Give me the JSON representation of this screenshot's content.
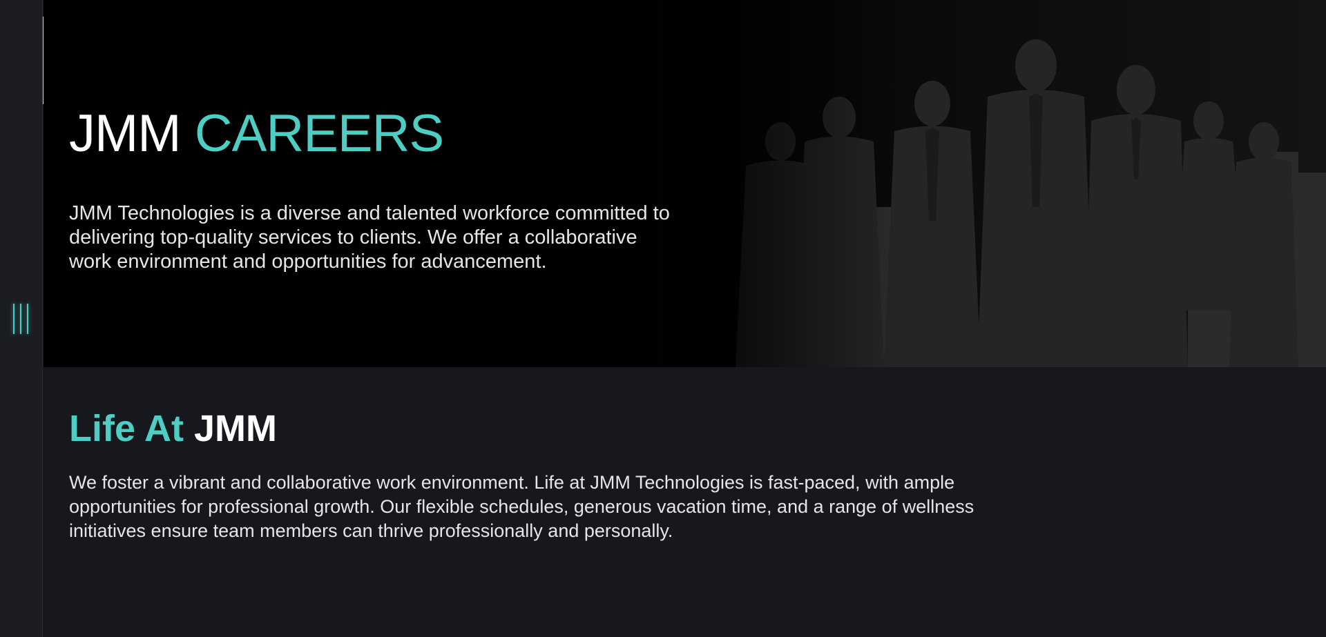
{
  "hero": {
    "title_main": "JMM",
    "title_accent": "CAREERS",
    "description": "JMM Technologies is a diverse and talented workforce committed to delivering top-quality services to clients. We offer a collaborative work environment and opportunities for advancement."
  },
  "life": {
    "title_accent": "Life At",
    "title_main": "JMM",
    "description": "We foster a vibrant and collaborative work environment. Life at JMM Technologies is fast-paced, with ample opportunities for professional growth. Our flexible schedules, generous vacation time, and a range of wellness initiatives ensure team members can thrive professionally and personally."
  },
  "sidebar": {
    "menu_icon": "menu-bars-icon"
  },
  "colors": {
    "accent": "#4ecdc4",
    "background": "#16181d",
    "hero_background": "#000000",
    "text": "#e4e6e8"
  }
}
